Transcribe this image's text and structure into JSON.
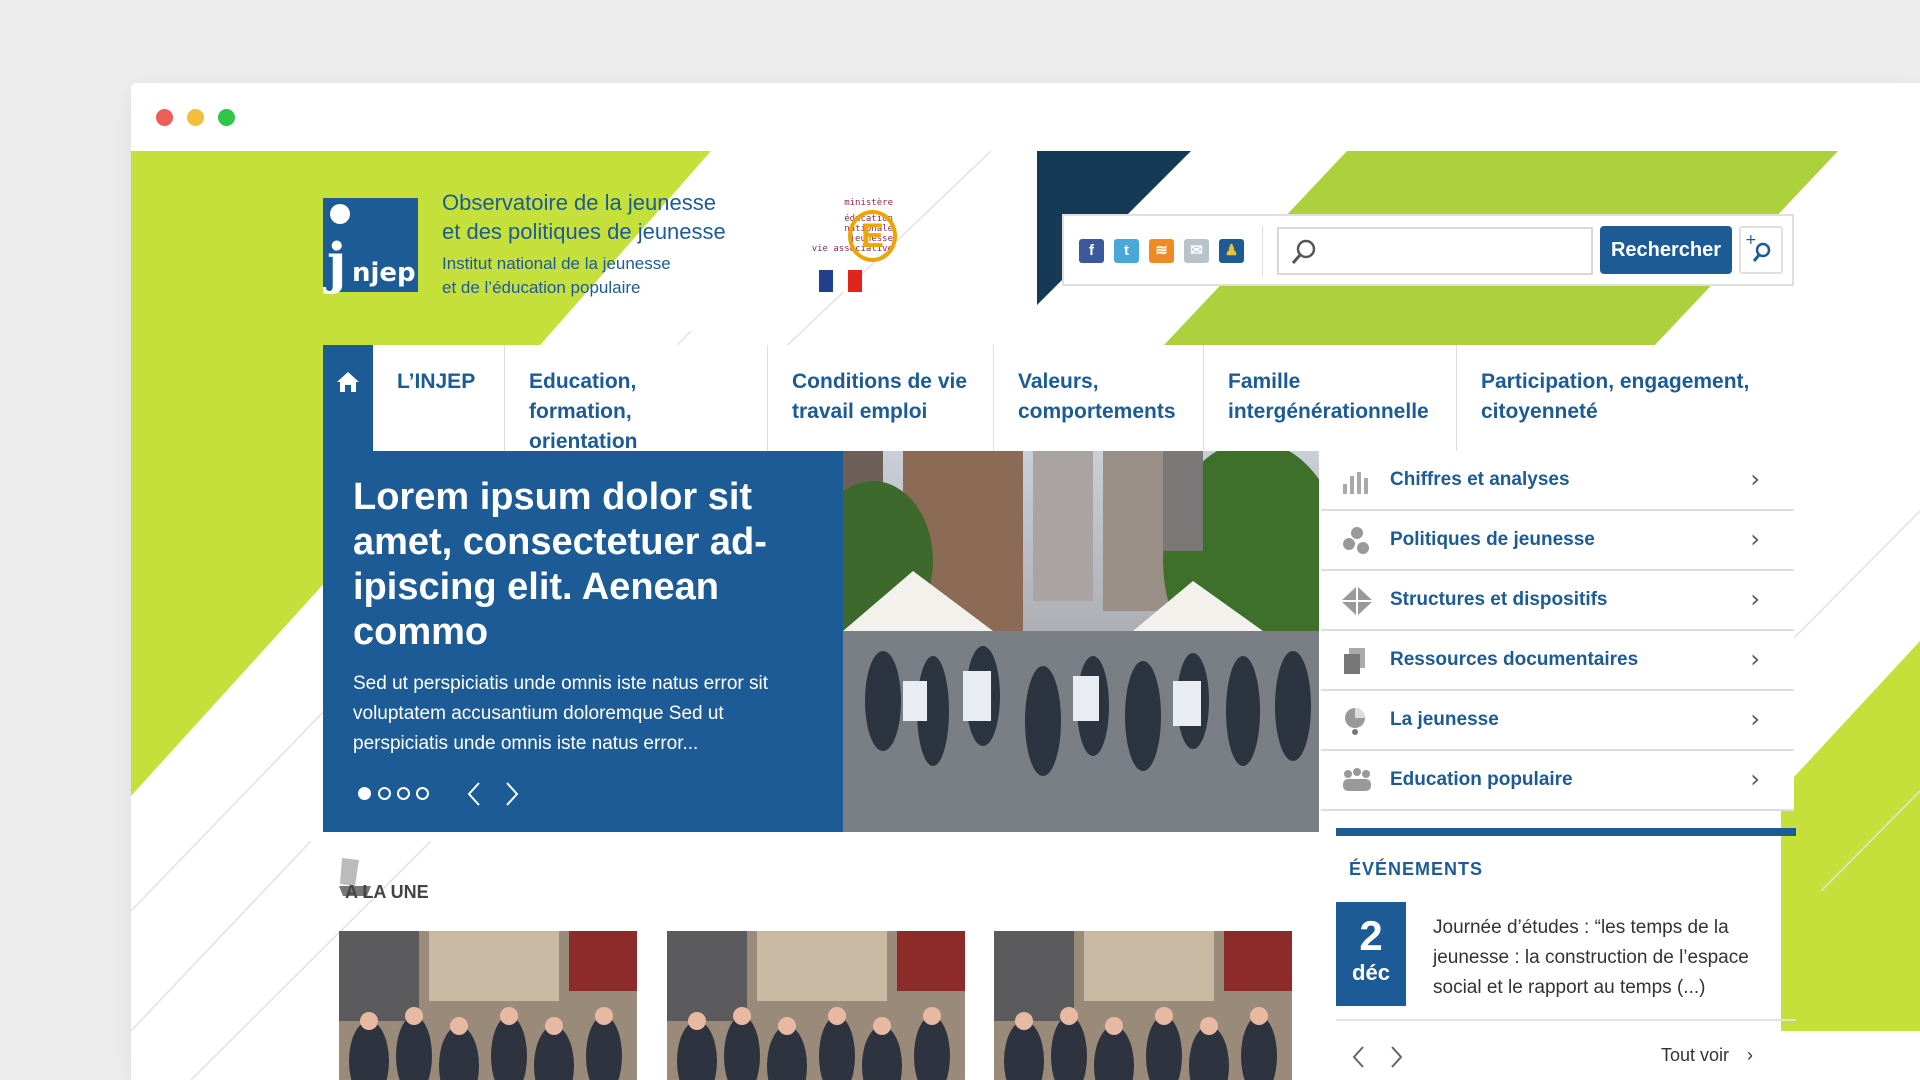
{
  "colors": {
    "brand_blue": "#1d5b96",
    "accent_green": "#c5e03b",
    "dark_navy": "#163a55",
    "mac_red": "#ee5d56",
    "mac_yellow": "#f4bd3d",
    "mac_green": "#2ec646"
  },
  "header": {
    "logo_text": "njep",
    "observatoire": [
      "Observatoire de la jeunesse",
      "et des politiques de jeunesse"
    ],
    "institut": [
      "Institut national de la jeunesse",
      "et de l’éducation populaire"
    ],
    "ministere": [
      "ministère",
      "éducation",
      "nationale",
      "jeunesse",
      "vie associative"
    ],
    "ministere_letter": "E"
  },
  "tools": {
    "social_icons": [
      {
        "name": "facebook-icon",
        "glyph": "f",
        "color": "#3b5998"
      },
      {
        "name": "twitter-icon",
        "glyph": "t",
        "color": "#4aa7d9"
      },
      {
        "name": "rss-icon",
        "glyph": "≋",
        "color": "#ef8b22"
      },
      {
        "name": "mail-icon",
        "glyph": "✉",
        "color": "#b9c3cb"
      },
      {
        "name": "accessibility-icon",
        "glyph": "♟",
        "color": "#1d5b96"
      }
    ],
    "search_value": "",
    "search_button": "Rechercher",
    "advanced_icon": "plus-search-icon"
  },
  "nav": {
    "home_icon": "home-icon",
    "items": [
      "L’INJEP",
      "Education, formation,\norientation",
      "Conditions de vie\ntravail emploi",
      "Valeurs,\ncomportements",
      "Famille\nintergénérationnelle",
      "Participation, engagement,\ncitoyenneté"
    ]
  },
  "hero": {
    "title": "Lorem ipsum dolor sit amet, consectetuer ad-ipiscing elit. Aenean commo",
    "text": "Sed ut perspiciatis unde omnis iste natus error sit voluptatem accusantium doloremque Sed ut perspiciatis unde omnis iste natus error...",
    "slides": 4,
    "active_slide": 1
  },
  "side_menu": [
    {
      "label": "Chiffres et analyses",
      "icon": "bar-chart-icon"
    },
    {
      "label": "Politiques de jeunesse",
      "icon": "dots-cluster-icon"
    },
    {
      "label": "Structures et dispositifs",
      "icon": "diamond-icon"
    },
    {
      "label": "Ressources documentaires",
      "icon": "documents-icon"
    },
    {
      "label": "La jeunesse",
      "icon": "pie-person-icon"
    },
    {
      "label": "Education populaire",
      "icon": "group-icon"
    }
  ],
  "events": {
    "heading": "ÉVÉNEMENTS",
    "day": "2",
    "month": "déc",
    "text": "Journée d’études : “les temps de la jeunesse : la construction de l’espace social et le rapport au temps (...)",
    "see_all": "Tout voir"
  },
  "una": {
    "heading": "A LA UNE",
    "thumb_count": 3
  }
}
